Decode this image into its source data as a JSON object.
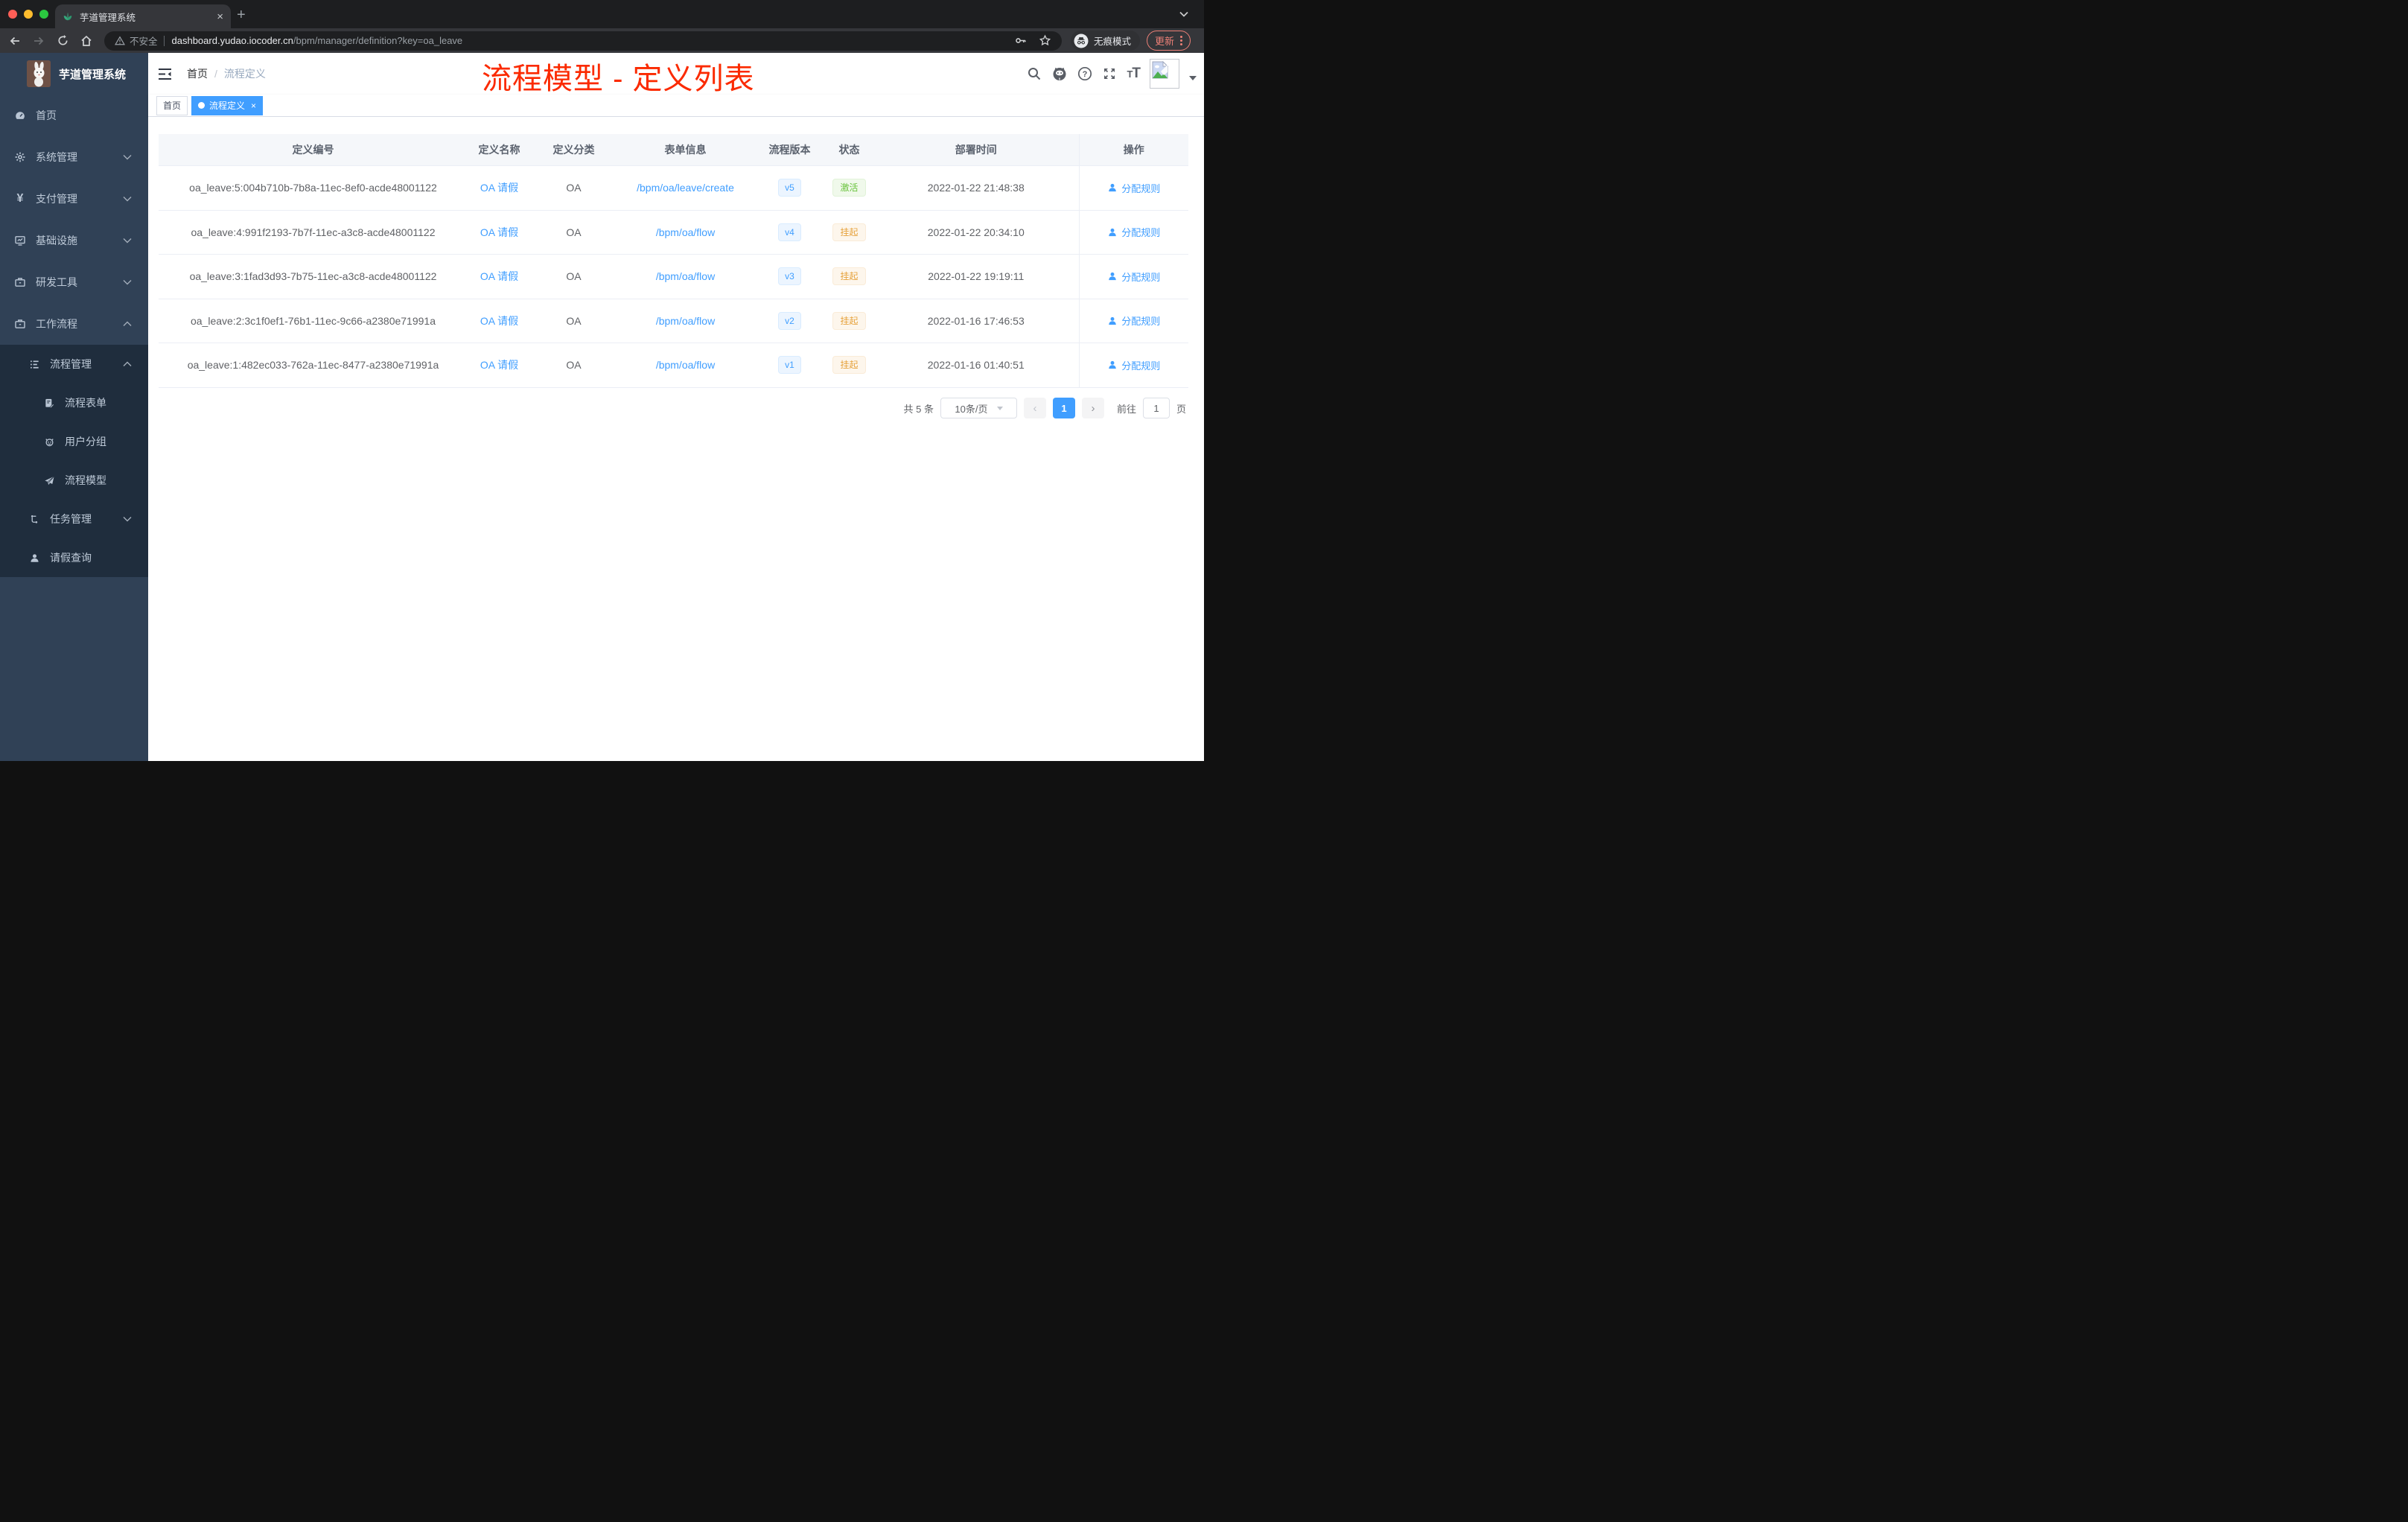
{
  "browser": {
    "tab": {
      "title": "芋道管理系统",
      "close": "×",
      "new_tab": "+"
    },
    "toolbar": {
      "security": "不安全",
      "url_host": "dashboard.yudao.iocoder.cn",
      "url_path": "/bpm/manager/definition?key=oa_leave",
      "incognito": "无痕模式",
      "update": "更新"
    }
  },
  "header": {
    "logo_title": "芋道管理系统",
    "breadcrumb": {
      "home": "首页",
      "sep": "/",
      "current": "流程定义"
    },
    "annotation": "流程模型 - 定义列表",
    "annotation_color": "#fb2a00"
  },
  "sidebar": {
    "items": [
      {
        "label": "首页",
        "icon": "dashboard-icon"
      },
      {
        "label": "系统管理",
        "icon": "gear-icon",
        "arrow": "down"
      },
      {
        "label": "支付管理",
        "icon": "yen-icon",
        "arrow": "down"
      },
      {
        "label": "基础设施",
        "icon": "monitor-icon",
        "arrow": "down"
      },
      {
        "label": "研发工具",
        "icon": "toolbox-icon",
        "arrow": "down"
      },
      {
        "label": "工作流程",
        "icon": "briefcase-icon",
        "arrow": "up"
      },
      {
        "label": "流程管理",
        "icon": "tree-list-icon",
        "arrow": "up",
        "level": 1
      },
      {
        "label": "流程表单",
        "icon": "form-icon",
        "level": 2
      },
      {
        "label": "用户分组",
        "icon": "robot-icon",
        "level": 2
      },
      {
        "label": "流程模型",
        "icon": "paper-plane-icon",
        "level": 2
      },
      {
        "label": "任务管理",
        "icon": "org-icon",
        "arrow": "down",
        "level": 1
      },
      {
        "label": "请假查询",
        "icon": "user-icon",
        "level": 1
      }
    ]
  },
  "tags": {
    "home": "首页",
    "active": "流程定义",
    "close": "×"
  },
  "table": {
    "columns": [
      "定义编号",
      "定义名称",
      "定义分类",
      "表单信息",
      "流程版本",
      "状态",
      "部署时间",
      "操作"
    ],
    "rows": [
      {
        "id": "oa_leave:5:004b710b-7b8a-11ec-8ef0-acde48001122",
        "name": "OA 请假",
        "category": "OA",
        "form": "/bpm/oa/leave/create",
        "version": "v5",
        "status": "激活",
        "status_type": "success",
        "time": "2022-01-22 21:48:38",
        "action": "分配规则"
      },
      {
        "id": "oa_leave:4:991f2193-7b7f-11ec-a3c8-acde48001122",
        "name": "OA 请假",
        "category": "OA",
        "form": "/bpm/oa/flow",
        "version": "v4",
        "status": "挂起",
        "status_type": "warning",
        "time": "2022-01-22 20:34:10",
        "action": "分配规则"
      },
      {
        "id": "oa_leave:3:1fad3d93-7b75-11ec-a3c8-acde48001122",
        "name": "OA 请假",
        "category": "OA",
        "form": "/bpm/oa/flow",
        "version": "v3",
        "status": "挂起",
        "status_type": "warning",
        "time": "2022-01-22 19:19:11",
        "action": "分配规则"
      },
      {
        "id": "oa_leave:2:3c1f0ef1-76b1-11ec-9c66-a2380e71991a",
        "name": "OA 请假",
        "category": "OA",
        "form": "/bpm/oa/flow",
        "version": "v2",
        "status": "挂起",
        "status_type": "warning",
        "time": "2022-01-16 17:46:53",
        "action": "分配规则"
      },
      {
        "id": "oa_leave:1:482ec033-762a-11ec-8477-a2380e71991a",
        "name": "OA 请假",
        "category": "OA",
        "form": "/bpm/oa/flow",
        "version": "v1",
        "status": "挂起",
        "status_type": "warning",
        "time": "2022-01-16 01:40:51",
        "action": "分配规则"
      }
    ]
  },
  "pagination": {
    "total": "共 5 条",
    "page_size": "10条/页",
    "prev": "‹",
    "current_page": "1",
    "next": "›",
    "goto_label": "前往",
    "goto_value": "1",
    "page_unit": "页"
  },
  "colors": {
    "accent": "#409eff",
    "status_active": "#67c23a",
    "status_suspended": "#e6a23c",
    "sidebar_bg": "#304156",
    "submenu_bg": "#1f2d3d"
  }
}
